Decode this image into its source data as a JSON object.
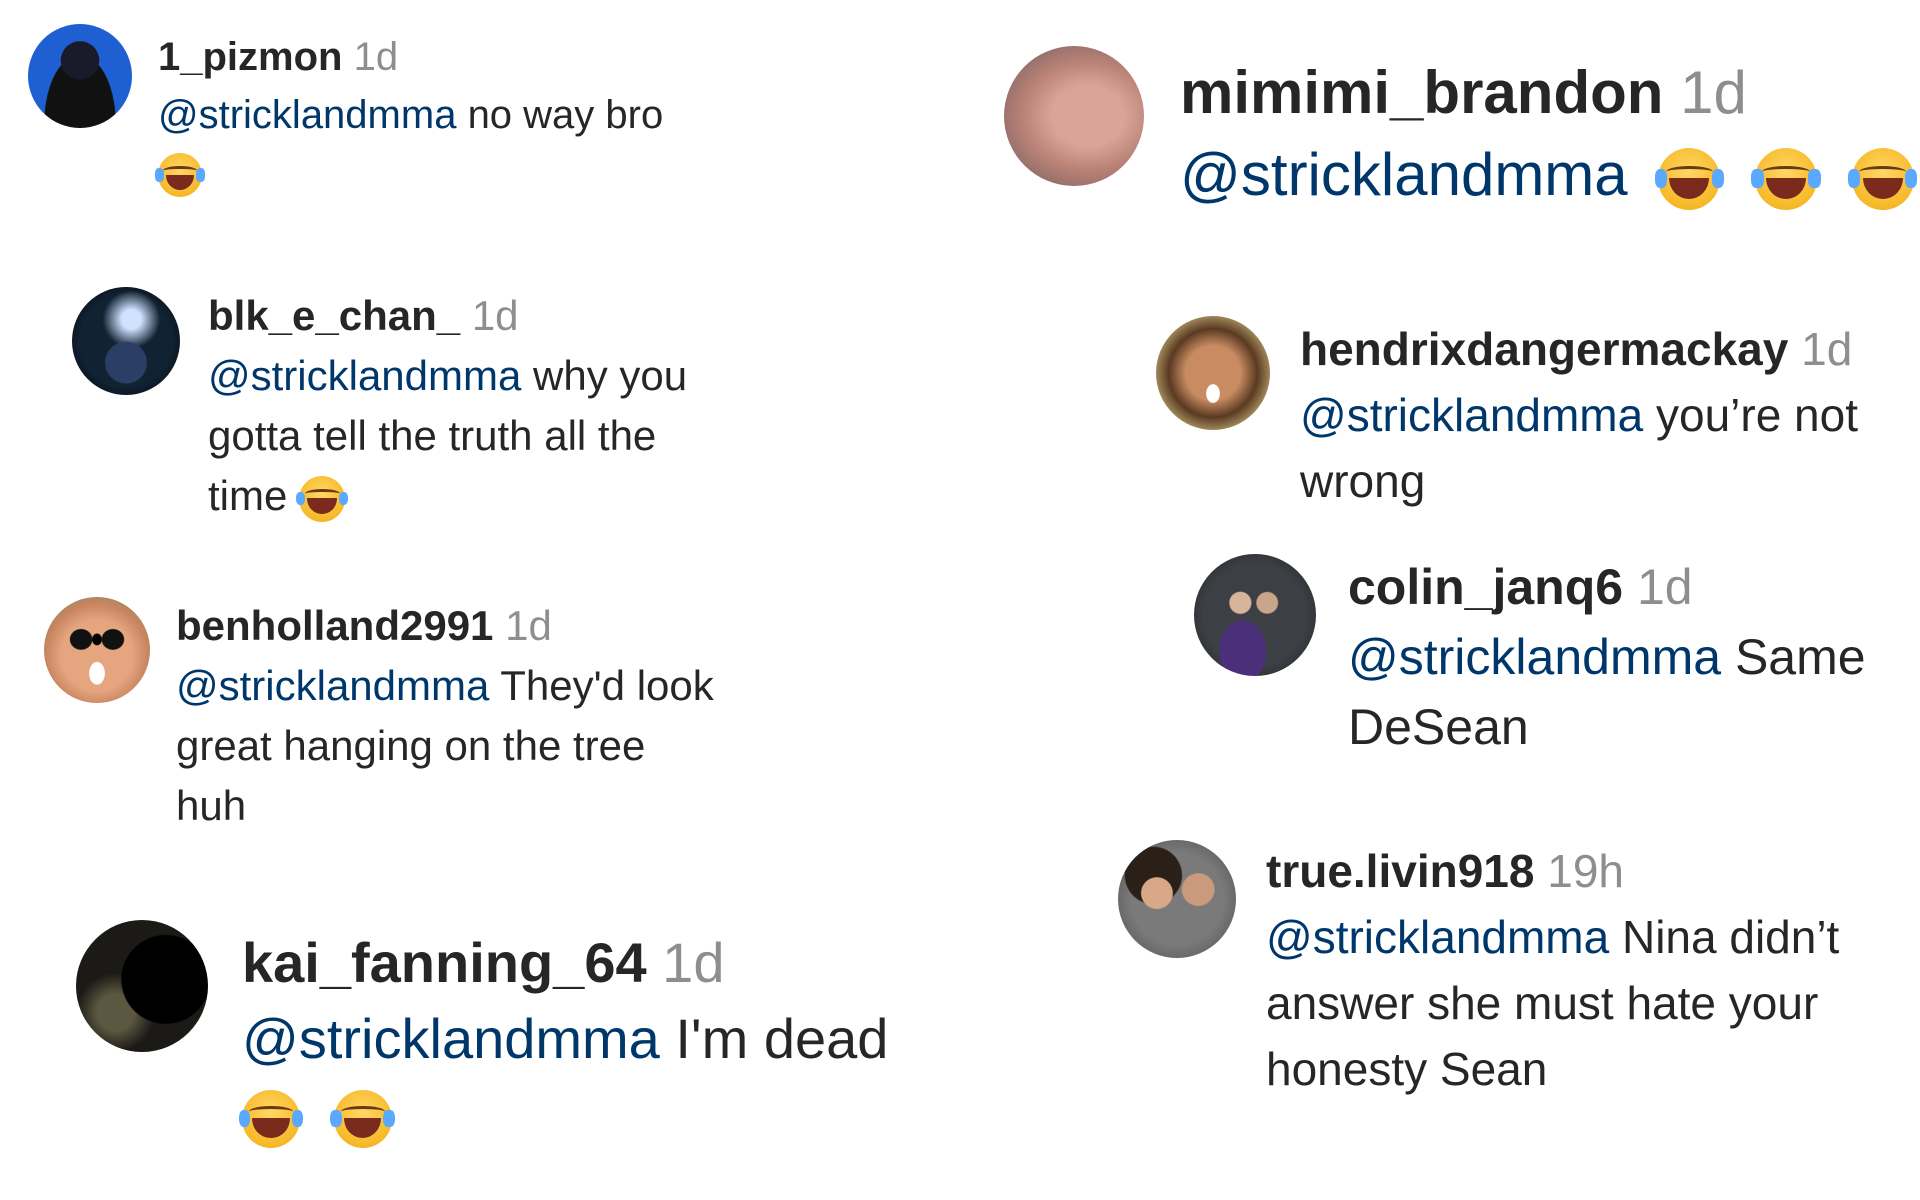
{
  "comments": [
    {
      "username": "1_pizmon",
      "time": "1d",
      "mention": "@stricklandmma",
      "text": "no way bro",
      "emoji": "laughing-crying-emoji"
    },
    {
      "username": "blk_e_chan_",
      "time": "1d",
      "mention": "@stricklandmma",
      "text_line1": "why you",
      "text_line2": "gotta tell the truth all the",
      "text_line3": "time",
      "emoji": "laughing-crying-emoji"
    },
    {
      "username": "benholland2991",
      "time": "1d",
      "mention": "@stricklandmma",
      "text_line1": "They'd look",
      "text_line2": "great hanging on the tree",
      "text_line3": "huh"
    },
    {
      "username": "kai_fanning_64",
      "time": "1d",
      "mention": "@stricklandmma",
      "text": "I'm dead",
      "emoji": "laughing-crying-emoji"
    },
    {
      "username": "mimimi_brandon",
      "time": "1d",
      "mention": "@stricklandmma",
      "emoji": "laughing-crying-emoji"
    },
    {
      "username": "hendrixdangermackay",
      "time": "1d",
      "mention": "@stricklandmma",
      "text_line1": "you’re not",
      "text_line2": "wrong"
    },
    {
      "username": "colin_janq6",
      "time": "1d",
      "mention": "@stricklandmma",
      "text_line1": "Same",
      "text_line2": "DeSean"
    },
    {
      "username": "true.livin918",
      "time": "19h",
      "mention": "@stricklandmma",
      "text_line1": "Nina didn’t",
      "text_line2": "answer she must hate your",
      "text_line3": "honesty Sean"
    }
  ],
  "colors": {
    "username": "#262626",
    "time": "#8e8e8e",
    "mention": "#00376b",
    "text": "#262626"
  }
}
